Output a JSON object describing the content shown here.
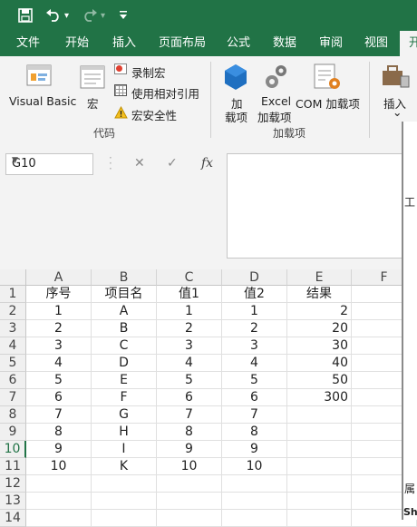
{
  "qat": {
    "save_icon": "save-icon",
    "undo_icon": "undo-icon",
    "redo_icon": "redo-icon",
    "customize_icon": "customize-icon",
    "undo_caret": "▾",
    "redo_caret": "▾"
  },
  "tabs": [
    "文件",
    "开始",
    "插入",
    "页面布局",
    "公式",
    "数据",
    "审阅",
    "视图",
    "开"
  ],
  "ribbon": {
    "visual_basic": "Visual Basic",
    "macros": "宏",
    "record_macro": "录制宏",
    "relative_refs": "使用相对引用",
    "macro_security": "宏安全性",
    "group_code": "代码",
    "addins_1": "加",
    "addins_2": "载项",
    "excel_addins_1": "Excel",
    "excel_addins_2": "加载项",
    "com_addins": "COM 加载项",
    "group_addins": "加载项",
    "insert": "插入",
    "insert_caret": "⌄"
  },
  "formula_bar": {
    "name_box": "G10",
    "cancel": "✕",
    "enter": "✓",
    "fx": "fx",
    "value": ""
  },
  "sheet": {
    "columns": [
      "A",
      "B",
      "C",
      "D",
      "E",
      "F"
    ],
    "rows": [
      [
        "序号",
        "项目名",
        "值1",
        "值2",
        "结果",
        ""
      ],
      [
        "1",
        "A",
        "1",
        "1",
        "2",
        ""
      ],
      [
        "2",
        "B",
        "2",
        "2",
        "20",
        ""
      ],
      [
        "3",
        "C",
        "3",
        "3",
        "30",
        ""
      ],
      [
        "4",
        "D",
        "4",
        "4",
        "40",
        ""
      ],
      [
        "5",
        "E",
        "5",
        "5",
        "50",
        ""
      ],
      [
        "6",
        "F",
        "6",
        "6",
        "300",
        ""
      ],
      [
        "7",
        "G",
        "7",
        "7",
        "",
        ""
      ],
      [
        "8",
        "H",
        "8",
        "8",
        "",
        ""
      ],
      [
        "9",
        "I",
        "9",
        "9",
        "",
        ""
      ],
      [
        "10",
        "K",
        "10",
        "10",
        "",
        ""
      ],
      [
        "",
        "",
        "",
        "",
        "",
        ""
      ],
      [
        "",
        "",
        "",
        "",
        "",
        ""
      ],
      [
        "",
        "",
        "",
        "",
        "",
        ""
      ]
    ],
    "row_numbers": [
      "1",
      "2",
      "3",
      "4",
      "5",
      "6",
      "7",
      "8",
      "9",
      "10",
      "11",
      "12",
      "13",
      "14"
    ],
    "selected_row": "10"
  },
  "vba_panel": {
    "project_label": "工",
    "properties_label": "属",
    "sheet_label": "Sh"
  }
}
